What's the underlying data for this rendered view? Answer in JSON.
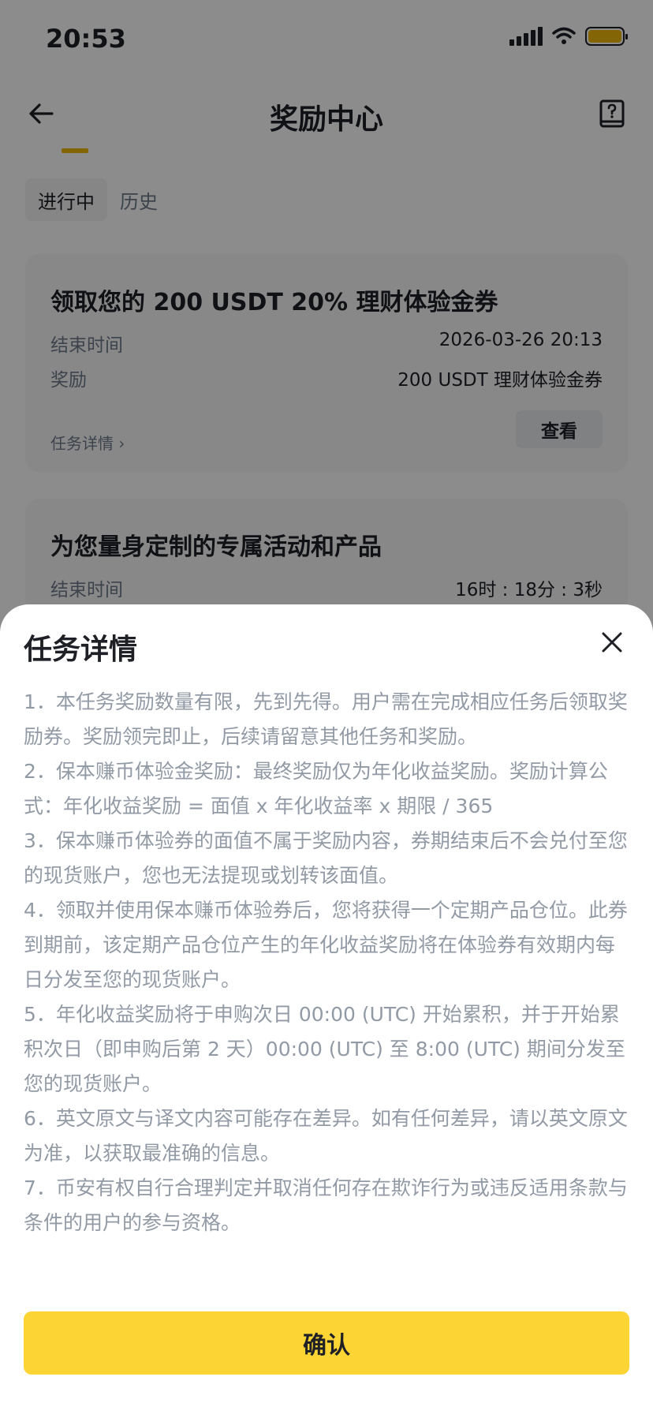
{
  "status_bar": {
    "time": "20:53"
  },
  "nav": {
    "title": "奖励中心"
  },
  "tabs": [
    {
      "label": "进行中",
      "active": true
    },
    {
      "label": "历史",
      "active": false
    }
  ],
  "cards": [
    {
      "title": "领取您的 200 USDT 20% 理财体验金券",
      "rows": [
        {
          "key": "结束时间",
          "value": "2026-03-26 20:13"
        },
        {
          "key": "奖励",
          "value": "200 USDT 理财体验金券"
        }
      ],
      "detail_link": "任务详情 ›",
      "action_label": "查看"
    },
    {
      "title": "为您量身定制的专属活动和产品",
      "rows": [
        {
          "key": "结束时间",
          "value": "16时 : 18分 : 3秒"
        }
      ]
    }
  ],
  "sheet": {
    "title": "任务详情",
    "rules": [
      "1．本任务奖励数量有限，先到先得。用户需在完成相应任务后领取奖励券。奖励领完即止，后续请留意其他任务和奖励。",
      "2．保本赚币体验金奖励：最终奖励仅为年化收益奖励。奖励计算公式：年化收益奖励 = 面值 x 年化收益率 x 期限 / 365",
      "3．保本赚币体验券的面值不属于奖励内容，券期结束后不会兑付至您的现货账户，您也无法提现或划转该面值。",
      "4．领取并使用保本赚币体验券后，您将获得一个定期产品仓位。此券到期前，该定期产品仓位产生的年化收益奖励将在体验券有效期内每日分发至您的现货账户。",
      "5．年化收益奖励将于申购次日 00:00 (UTC) 开始累积，并于开始累积次日（即申购后第 2 天）00:00 (UTC) 至 8:00 (UTC) 期间分发至您的现货账户。",
      "6．英文原文与译文内容可能存在差异。如有任何差异，请以英文原文为准，以获取最准确的信息。",
      "7．币安有权自行合理判定并取消任何存在欺诈行为或违反适用条款与条件的用户的参与资格。"
    ],
    "confirm_label": "确认"
  },
  "colors": {
    "accent": "#fcd535",
    "tab_indicator": "#f0b90b",
    "text_primary": "#1e2026",
    "text_secondary": "#707a8a",
    "rule_text": "#929aa5",
    "overlay": "rgba(0,0,0,0.45)"
  },
  "icons": {
    "back": "arrow-left-icon",
    "help": "help-book-icon",
    "close": "close-icon",
    "signal": "cellular-signal-icon",
    "wifi": "wifi-icon",
    "battery": "battery-icon"
  }
}
